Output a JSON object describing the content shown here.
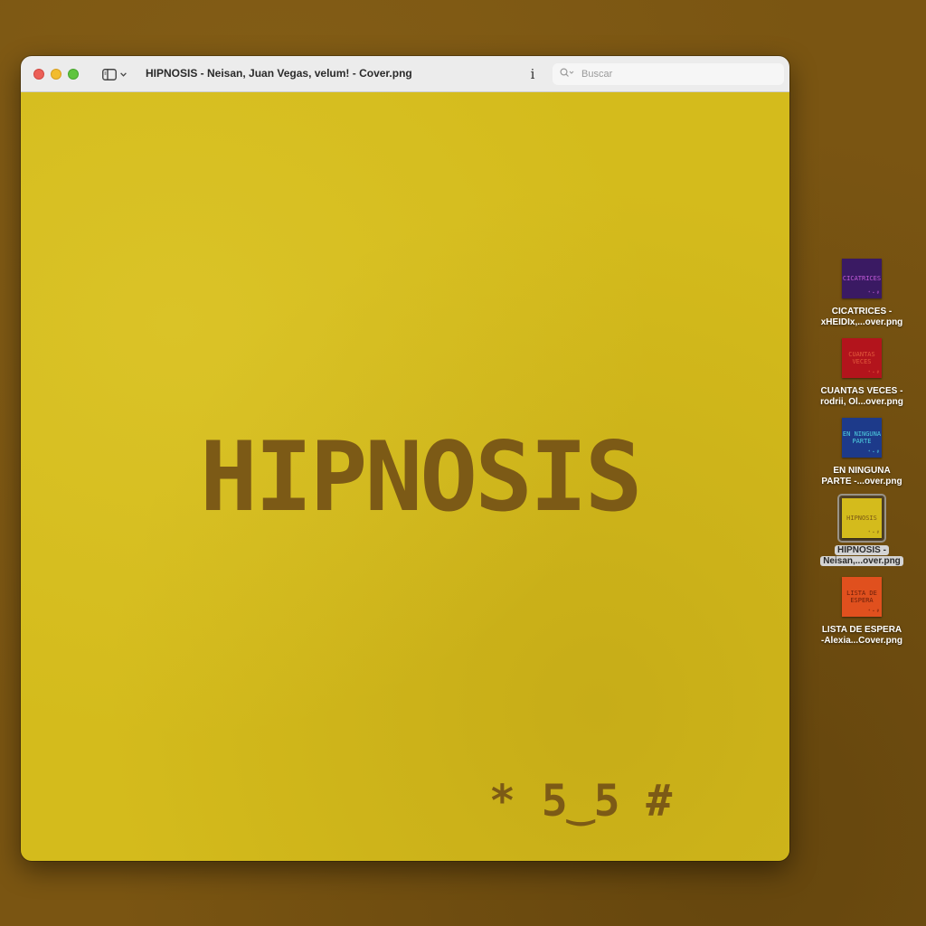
{
  "window": {
    "title": "HIPNOSIS - Neisan, Juan Vegas, velum! - Cover.png",
    "info_glyph": "i",
    "search_placeholder": "Buscar"
  },
  "cover": {
    "title": "HIPNOSIS",
    "mark": "* 5‿5 #",
    "background_color": "#d4bb1c",
    "text_color": "#7c5a16"
  },
  "desktop": {
    "background_color": "#7a5512",
    "files": [
      {
        "line1": "CICATRICES -",
        "line2": "xHEIDIx,...over.png",
        "thumb_text": "CICATRICES",
        "thumb_bg": "#3a1a63",
        "thumb_fg": "#c25bd9",
        "selected": false
      },
      {
        "line1": "CUANTAS VECES -",
        "line2": "rodrii, Ol...over.png",
        "thumb_text": "CUANTAS VECES",
        "thumb_bg": "#b3141c",
        "thumb_fg": "#e25a3c",
        "selected": false
      },
      {
        "line1": "EN NINGUNA",
        "line2": "PARTE -...over.png",
        "thumb_text": "EN NINGUNA PARTE",
        "thumb_bg": "#1d3a8a",
        "thumb_fg": "#4fd0e0",
        "selected": false
      },
      {
        "line1": "HIPNOSIS -",
        "line2": "Neisan,...over.png",
        "thumb_text": "HIPNOSIS",
        "thumb_bg": "#d4bb1c",
        "thumb_fg": "#7c5a16",
        "selected": true
      },
      {
        "line1": "LISTA DE ESPERA",
        "line2": "-Alexia...Cover.png",
        "thumb_text": "LISTA DE ESPERA",
        "thumb_bg": "#e0501e",
        "thumb_fg": "#6a1f0a",
        "selected": false
      }
    ]
  }
}
